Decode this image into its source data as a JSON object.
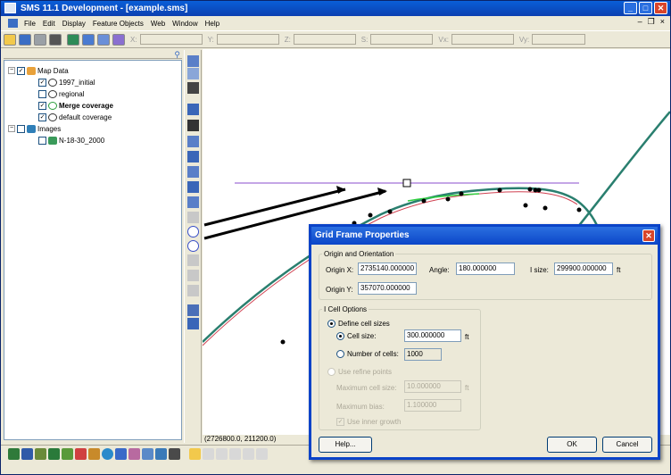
{
  "window": {
    "title": "SMS 11.1 Development - [example.sms]"
  },
  "menu": [
    "File",
    "Edit",
    "Display",
    "Feature Objects",
    "Web",
    "Window",
    "Help"
  ],
  "toolbar": {
    "coord_labels": [
      "X:",
      "Y:",
      "Z:",
      "S:",
      "Vx:",
      "Vy:"
    ]
  },
  "tree": {
    "root": "Map Data",
    "coverages": [
      "1997_initial",
      "regional",
      "Merge coverage",
      "default coverage"
    ],
    "images": "Images",
    "image_items": [
      "N-18-30_2000"
    ]
  },
  "status": {
    "coords": "(2726800.0, 211200.0)"
  },
  "dialog": {
    "title": "Grid Frame Properties",
    "origin_group": "Origin and Orientation",
    "origin_x_label": "Origin X:",
    "origin_x_value": "2735140.000000",
    "origin_y_label": "Origin Y:",
    "origin_y_value": "357070.000000",
    "angle_label": "Angle:",
    "angle_value": "180.000000",
    "isize_label": "I size:",
    "isize_value": "299900.000000",
    "isize_unit": "ft",
    "icell_group": "I Cell Options",
    "define_cell_sizes": "Define cell sizes",
    "cell_size_label": "Cell size:",
    "cell_size_value": "300.000000",
    "cell_size_unit": "ft",
    "num_cells_label": "Number of cells:",
    "num_cells_value": "1000",
    "use_refine_points": "Use refine points",
    "max_cell_size_label": "Maximum cell size:",
    "max_cell_size_value": "10.000000",
    "max_cell_size_unit": "ft",
    "max_bias_label": "Maximum bias:",
    "max_bias_value": "1.100000",
    "use_inner_growth": "Use inner growth",
    "help_button": "Help...",
    "ok_button": "OK",
    "cancel_button": "Cancel"
  }
}
